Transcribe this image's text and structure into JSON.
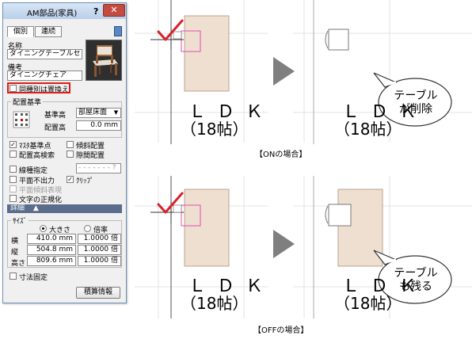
{
  "dialog": {
    "title": "AM部品(家具)",
    "help_label": "?",
    "close_label": "✕",
    "tabs": [
      {
        "label": "個別"
      },
      {
        "label": "連続"
      }
    ],
    "name_label": "名称",
    "name_value": "ダイニングテーブルセッ",
    "note_label": "備考",
    "note_value": "ダイニングチェア",
    "replace_same": {
      "label": "同種別は置換え",
      "checked": false
    },
    "placement_title": "配置基準",
    "base_height_label": "基準高",
    "base_height_value": "部屋床面",
    "placement_height_label": "配置高",
    "placement_height_value": "0.0 mm",
    "checks": [
      {
        "label": "ﾏｽﾀ基準点",
        "checked": true,
        "disabled": false
      },
      {
        "label": "傾斜配置",
        "checked": false,
        "disabled": false
      },
      {
        "label": "配置高検索",
        "checked": false,
        "disabled": false
      },
      {
        "label": "隙間配置",
        "checked": false,
        "disabled": false
      },
      {
        "label": "線種指定",
        "checked": false,
        "disabled": false
      },
      {
        "label": "平面不出力",
        "checked": false,
        "disabled": false
      },
      {
        "label": "ｸﾘｯﾌﾟ",
        "checked": true,
        "disabled": false
      },
      {
        "label": "平面傾斜表現",
        "checked": false,
        "disabled": true
      },
      {
        "label": "文字の正規化",
        "checked": false,
        "disabled": false
      }
    ],
    "linetype_value": "- - - - - - -  ?",
    "details_label": "詳細",
    "size_title": "ｻｲｽﾞ",
    "size_mode": {
      "size_label": "大きさ",
      "ratio_label": "倍率",
      "selected": "大きさ"
    },
    "dims": [
      {
        "label": "横",
        "mm": "410.0 mm",
        "ratio": "1.0000 倍"
      },
      {
        "label": "縦",
        "mm": "504.8 mm",
        "ratio": "1.0000 倍"
      },
      {
        "label": "高さ",
        "mm": "809.6 mm",
        "ratio": "1.0000 倍"
      }
    ],
    "fix_dims": {
      "label": "寸法固定",
      "checked": false
    },
    "estimate_button": "積算情報"
  },
  "scenes": [
    {
      "caption": "【ONの場合】",
      "ldk": "ＬＤＫ",
      "tatami": "（18帖）",
      "bubble": [
        "テーブル",
        "が削除"
      ]
    },
    {
      "caption": "【OFFの場合】",
      "ldk": "ＬＤＫ",
      "tatami": "（18帖）",
      "bubble": [
        "テーブル",
        "も残る"
      ]
    }
  ],
  "colors": {
    "accent_red": "#e01b1b",
    "table_fill": "#eedfd0",
    "guide_magenta": "#e24db0",
    "arrow_gray": "#7f7f7f"
  }
}
